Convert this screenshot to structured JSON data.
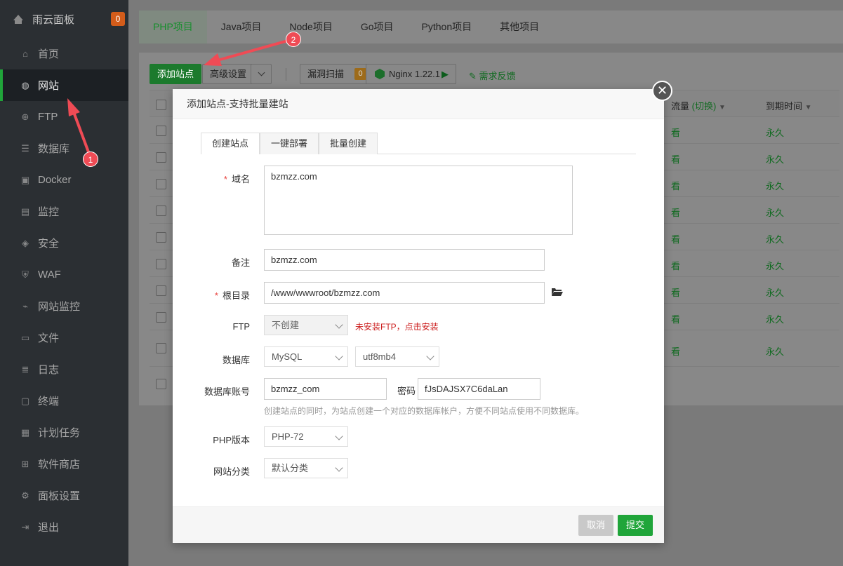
{
  "sidebar": {
    "app_title": "雨云面板",
    "badge": "0",
    "items": [
      {
        "label": "首页",
        "icon": "home-icon"
      },
      {
        "label": "网站",
        "icon": "globe-icon"
      },
      {
        "label": "FTP",
        "icon": "ftp-icon"
      },
      {
        "label": "数据库",
        "icon": "database-icon"
      },
      {
        "label": "Docker",
        "icon": "docker-icon"
      },
      {
        "label": "监控",
        "icon": "monitor-icon"
      },
      {
        "label": "安全",
        "icon": "shield-icon"
      },
      {
        "label": "WAF",
        "icon": "waf-icon"
      },
      {
        "label": "网站监控",
        "icon": "chart-icon"
      },
      {
        "label": "文件",
        "icon": "folder-icon"
      },
      {
        "label": "日志",
        "icon": "log-icon"
      },
      {
        "label": "终端",
        "icon": "terminal-icon"
      },
      {
        "label": "计划任务",
        "icon": "calendar-icon"
      },
      {
        "label": "软件商店",
        "icon": "grid-icon"
      },
      {
        "label": "面板设置",
        "icon": "gear-icon"
      },
      {
        "label": "退出",
        "icon": "logout-icon"
      }
    ]
  },
  "tabs": [
    "PHP项目",
    "Java项目",
    "Node项目",
    "Go项目",
    "Python项目",
    "其他项目"
  ],
  "toolbar": {
    "add_site": "添加站点",
    "advanced": "高级设置",
    "scan": "漏洞扫描",
    "scan_count": "0",
    "nginx": "Nginx 1.22.1",
    "feedback": "需求反馈"
  },
  "table": {
    "col_traffic": "流量",
    "col_traffic_switch": "(切换)",
    "col_expire": "到期时间",
    "row_view": "看",
    "row_expire": "永久"
  },
  "annotations": {
    "one": "1",
    "two": "2"
  },
  "modal": {
    "title": "添加站点-支持批量建站",
    "tabs": [
      "创建站点",
      "一键部署",
      "批量创建"
    ],
    "domain_label": "域名",
    "domain_value": "bzmzz.com",
    "remark_label": "备注",
    "remark_value": "bzmzz.com",
    "root_label": "根目录",
    "root_value": "/www/wwwroot/bzmzz.com",
    "ftp_label": "FTP",
    "ftp_value": "不创建",
    "ftp_warning": "未安装FTP，点击安装",
    "db_label": "数据库",
    "db_value": "MySQL",
    "charset_value": "utf8mb4",
    "db_account_label": "数据库账号",
    "db_account_value": "bzmzz_com",
    "password_label": "密码",
    "password_value": "fJsDAJSX7C6daLan",
    "db_hint": "创建站点的同时，为站点创建一个对应的数据库帐户，方便不同站点使用不同数据库。",
    "php_label": "PHP版本",
    "php_value": "PHP-72",
    "category_label": "网站分类",
    "category_value": "默认分类",
    "cancel": "取消",
    "submit": "提交"
  }
}
